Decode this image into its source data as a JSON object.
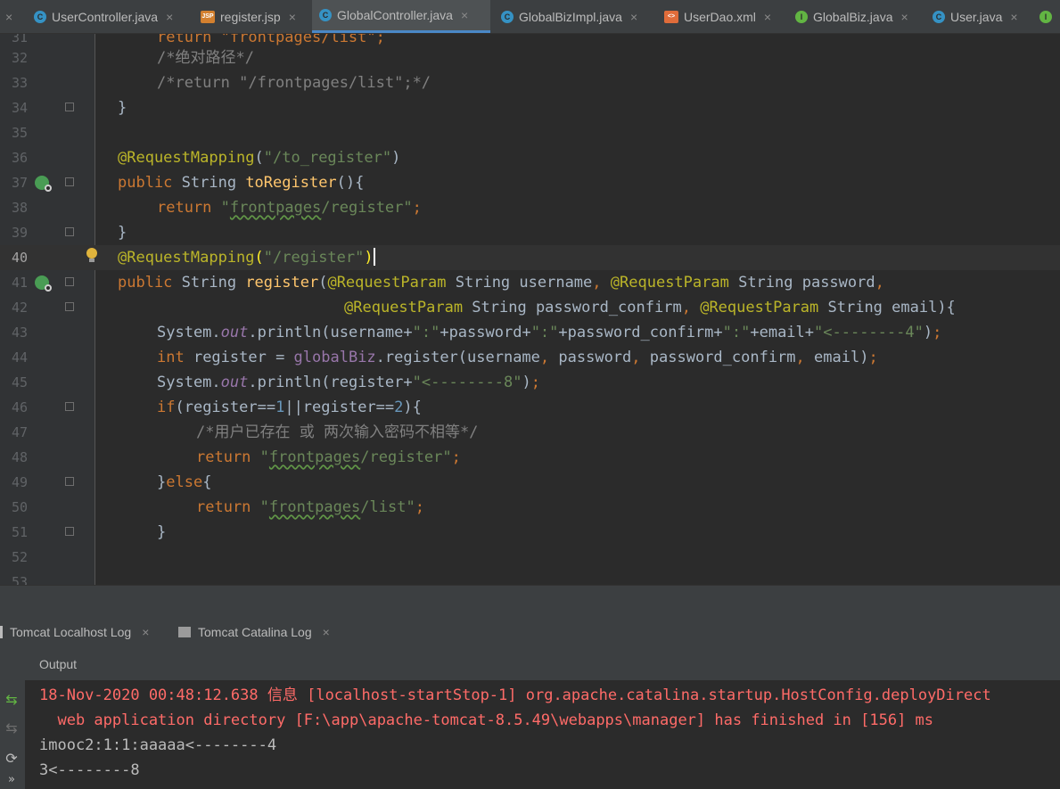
{
  "tabs": [
    {
      "label": "UserController.java",
      "icon": "class-c-icon"
    },
    {
      "label": "register.jsp",
      "icon": "jsp-icon"
    },
    {
      "label": "GlobalController.java",
      "icon": "class-c-icon",
      "active": true
    },
    {
      "label": "GlobalBizImpl.java",
      "icon": "class-c-icon"
    },
    {
      "label": "UserDao.xml",
      "icon": "xml-icon"
    },
    {
      "label": "GlobalBiz.java",
      "icon": "interface-i-icon"
    },
    {
      "label": "User.java",
      "icon": "class-c-icon"
    }
  ],
  "tab_close": "×",
  "icon_letters": {
    "c": "C",
    "i": "I",
    "jsp": "JSP",
    "xml": "<>"
  },
  "line_numbers": [
    "31",
    "32",
    "33",
    "34",
    "35",
    "36",
    "37",
    "38",
    "39",
    "40",
    "41",
    "42",
    "43",
    "44",
    "45",
    "46",
    "47",
    "48",
    "49",
    "50",
    "51",
    "52",
    "53"
  ],
  "code": {
    "l31": "return \"frontpages/list\";",
    "l32": "/*绝对路径*/",
    "l33": "/*return \"/frontpages/list\";*/",
    "l34": "}",
    "l36_ann": "@RequestMapping",
    "l36_str": "\"/to_register\"",
    "l37_mod": "public",
    "l37_type": " String ",
    "l37_fn": "toRegister",
    "l37_rest": "(){",
    "l38_kw": "return",
    "l38_q1": "\"",
    "l38_path": "frontpages",
    "l38_rest": "/register\"",
    "l39": "}",
    "l40_ann": "@RequestMapping",
    "l40_str": "\"/register\"",
    "l41_mod": "public",
    "l41_type": " String ",
    "l41_fn": "register",
    "l41_ann1": "@RequestParam",
    "l41_p1": " String username",
    "l41_ann2": "@RequestParam",
    "l41_p2": " String password",
    "l42_ann1": "@RequestParam",
    "l42_p1": " String password_confirm",
    "l42_ann2": "@RequestParam",
    "l42_p2": " String email){",
    "l43_a": "System.",
    "l43_out": "out",
    "l43_b": ".println(username+",
    "l43_s1": "\":\"",
    "l43_c": "+password+",
    "l43_s2": "\":\"",
    "l43_d": "+password_confirm+",
    "l43_s3": "\":\"",
    "l43_e": "+email+",
    "l43_s4": "\"<--------4\"",
    "l43_f": ")",
    "l44_kw": "int",
    "l44_a": " register = ",
    "l44_biz": "globalBiz",
    "l44_b": ".register(username",
    "l44_c": " password",
    "l44_d": " password_confirm",
    "l44_e": " email)",
    "l45_a": "System.",
    "l45_out": "out",
    "l45_b": ".println(register+",
    "l45_s": "\"<--------8\"",
    "l45_c": ")",
    "l46_kw": "if",
    "l46_a": "(register==",
    "l46_n1": "1",
    "l46_b": "||register==",
    "l46_n2": "2",
    "l46_c": "){",
    "l47": "/*用户已存在 或 两次输入密码不相等*/",
    "l48_kw": "return",
    "l48_q": "\"",
    "l48_path": "frontpages",
    "l48_rest": "/register\"",
    "l49_a": "}",
    "l49_kw": "else",
    "l49_b": "{",
    "l50_kw": "return",
    "l50_q": "\"",
    "l50_path": "frontpages",
    "l50_rest": "/list\"",
    "l51": "}"
  },
  "run_tabs": [
    {
      "label": "Tomcat Localhost Log"
    },
    {
      "label": "Tomcat Catalina Log"
    }
  ],
  "output": {
    "title": "Output",
    "lines": [
      {
        "text": "18-Nov-2020 00:48:12.638 信息 [localhost-startStop-1] org.apache.catalina.startup.HostConfig.deployDirect",
        "style": "red"
      },
      {
        "text": "  web application directory [F:\\app\\apache-tomcat-8.5.49\\webapps\\manager] has finished in [156] ms",
        "style": "red"
      },
      {
        "text": "imooc2:1:1:aaaaa<--------4",
        "style": "normal"
      },
      {
        "text": "3<--------8",
        "style": "normal"
      }
    ]
  },
  "side_icons": {
    "rerun": "⇆",
    "restart": "⟳",
    "more": "»"
  },
  "colors": {
    "keyword": "#cc7832",
    "annotation": "#bbb529",
    "string": "#6a8759",
    "comment": "#808080",
    "error_output": "#ff6b68",
    "active_tab_underline": "#4a88c7"
  }
}
